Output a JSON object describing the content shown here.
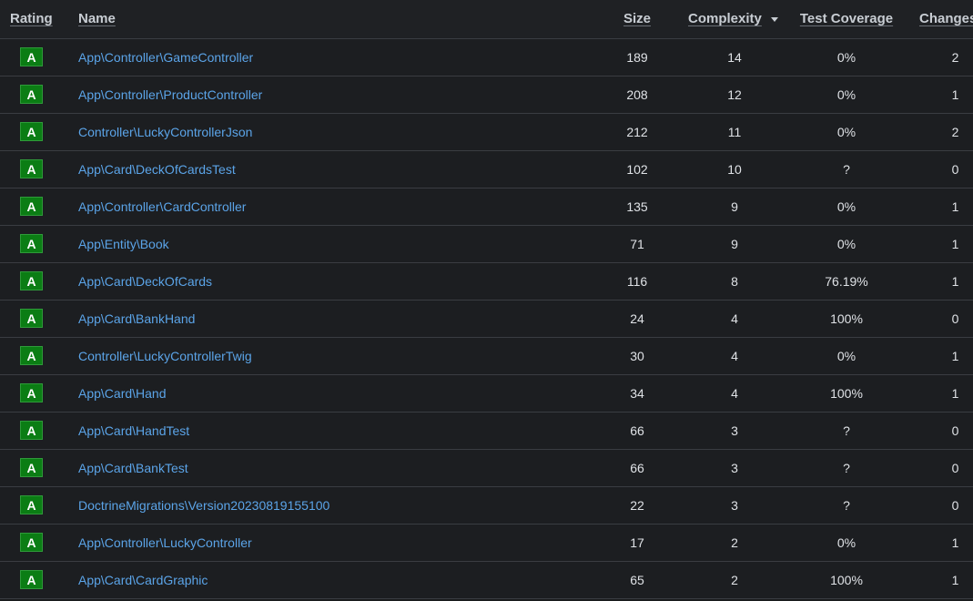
{
  "columns": {
    "rating": "Rating",
    "name": "Name",
    "size": "Size",
    "complexity": "Complexity",
    "coverage": "Test Coverage",
    "changes": "Changes"
  },
  "sort": {
    "column": "complexity",
    "direction": "desc",
    "icon": "sort-desc-icon"
  },
  "colors": {
    "badge": "#0b7d14",
    "link": "#5ba4e8",
    "background": "#1c1e21"
  },
  "rows": [
    {
      "rating": "A",
      "name": "App\\Controller\\GameController",
      "size": "189",
      "complexity": "14",
      "coverage": "0%",
      "changes": "2"
    },
    {
      "rating": "A",
      "name": "App\\Controller\\ProductController",
      "size": "208",
      "complexity": "12",
      "coverage": "0%",
      "changes": "1"
    },
    {
      "rating": "A",
      "name": "Controller\\LuckyControllerJson",
      "size": "212",
      "complexity": "11",
      "coverage": "0%",
      "changes": "2"
    },
    {
      "rating": "A",
      "name": "App\\Card\\DeckOfCardsTest",
      "size": "102",
      "complexity": "10",
      "coverage": "?",
      "changes": "0"
    },
    {
      "rating": "A",
      "name": "App\\Controller\\CardController",
      "size": "135",
      "complexity": "9",
      "coverage": "0%",
      "changes": "1"
    },
    {
      "rating": "A",
      "name": "App\\Entity\\Book",
      "size": "71",
      "complexity": "9",
      "coverage": "0%",
      "changes": "1"
    },
    {
      "rating": "A",
      "name": "App\\Card\\DeckOfCards",
      "size": "116",
      "complexity": "8",
      "coverage": "76.19%",
      "changes": "1"
    },
    {
      "rating": "A",
      "name": "App\\Card\\BankHand",
      "size": "24",
      "complexity": "4",
      "coverage": "100%",
      "changes": "0"
    },
    {
      "rating": "A",
      "name": "Controller\\LuckyControllerTwig",
      "size": "30",
      "complexity": "4",
      "coverage": "0%",
      "changes": "1"
    },
    {
      "rating": "A",
      "name": "App\\Card\\Hand",
      "size": "34",
      "complexity": "4",
      "coverage": "100%",
      "changes": "1"
    },
    {
      "rating": "A",
      "name": "App\\Card\\HandTest",
      "size": "66",
      "complexity": "3",
      "coverage": "?",
      "changes": "0"
    },
    {
      "rating": "A",
      "name": "App\\Card\\BankTest",
      "size": "66",
      "complexity": "3",
      "coverage": "?",
      "changes": "0"
    },
    {
      "rating": "A",
      "name": "DoctrineMigrations\\Version20230819155100",
      "size": "22",
      "complexity": "3",
      "coverage": "?",
      "changes": "0"
    },
    {
      "rating": "A",
      "name": "App\\Controller\\LuckyController",
      "size": "17",
      "complexity": "2",
      "coverage": "0%",
      "changes": "1"
    },
    {
      "rating": "A",
      "name": "App\\Card\\CardGraphic",
      "size": "65",
      "complexity": "2",
      "coverage": "100%",
      "changes": "1"
    }
  ]
}
